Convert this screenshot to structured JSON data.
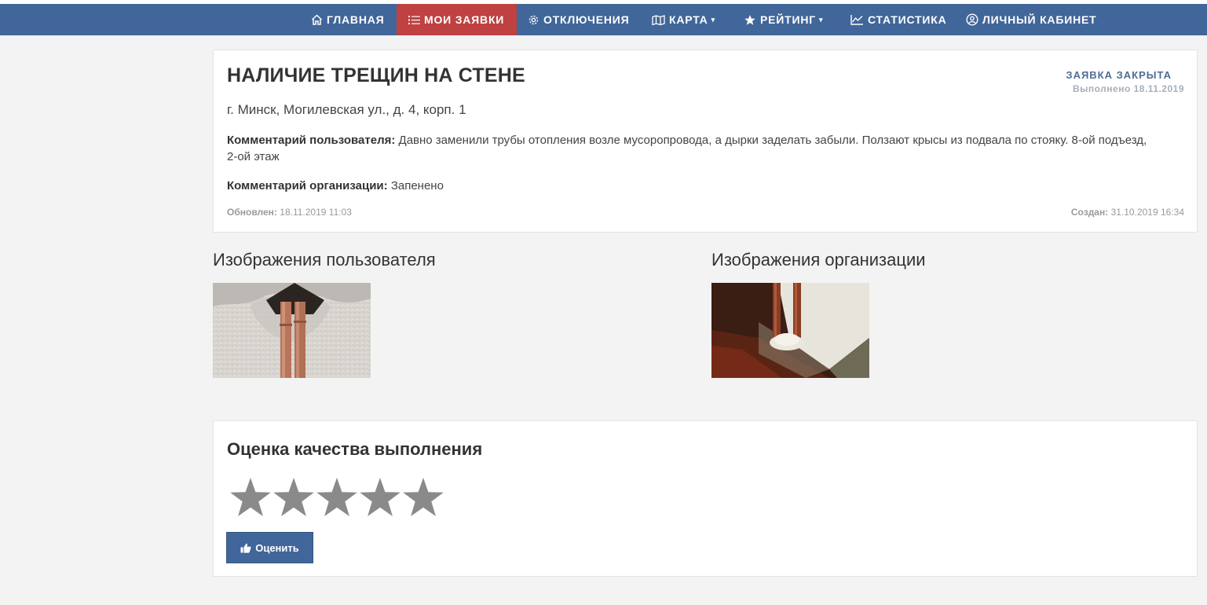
{
  "nav": {
    "items": [
      {
        "label": "ГЛАВНАЯ",
        "icon": "home-icon"
      },
      {
        "label": "МОИ ЗАЯВКИ",
        "icon": "list-icon",
        "active": true
      },
      {
        "label": "ОТКЛЮЧЕНИЯ",
        "icon": "gear-icon"
      },
      {
        "label": "КАРТА",
        "icon": "map-icon",
        "dropdown": true
      },
      {
        "label": "РЕЙТИНГ",
        "icon": "star-icon",
        "dropdown": true
      },
      {
        "label": "СТАТИСТИКА",
        "icon": "chart-icon"
      },
      {
        "label": "ЛИЧНЫЙ КАБИНЕТ",
        "icon": "user-icon"
      }
    ],
    "caret": "▾"
  },
  "request": {
    "title": "НАЛИЧИЕ ТРЕЩИН НА СТЕНЕ",
    "status": "ЗАЯВКА ЗАКРЫТА",
    "status_date": "Выполнено 18.11.2019",
    "address": "г. Минск, Могилевская ул., д. 4, корп. 1",
    "user_comment_label": "Комментарий пользователя:",
    "user_comment": "Давно заменили трубы отопления возле мусоропровода, а дырки заделать забыли. Ползают крысы из подвала по стояку. 8-ой подъезд, 2-ой этаж",
    "org_comment_label": "Комментарий организации:",
    "org_comment": "Запенено",
    "updated_label": "Обновлен:",
    "updated": "18.11.2019 11:03",
    "created_label": "Создан:",
    "created": "31.10.2019 16:34"
  },
  "images": {
    "user_title": "Изображения пользователя",
    "org_title": "Изображения организации"
  },
  "rating": {
    "title": "Оценка качества выполнения",
    "stars_total": 5,
    "stars_selected": 0,
    "button_label": "Оценить",
    "button_icon": "thumbs-up-icon"
  },
  "colors": {
    "navbar": "#41669a",
    "active_tab": "#bf4141",
    "status": "#4f6d96",
    "star": "#8a8a8a"
  }
}
